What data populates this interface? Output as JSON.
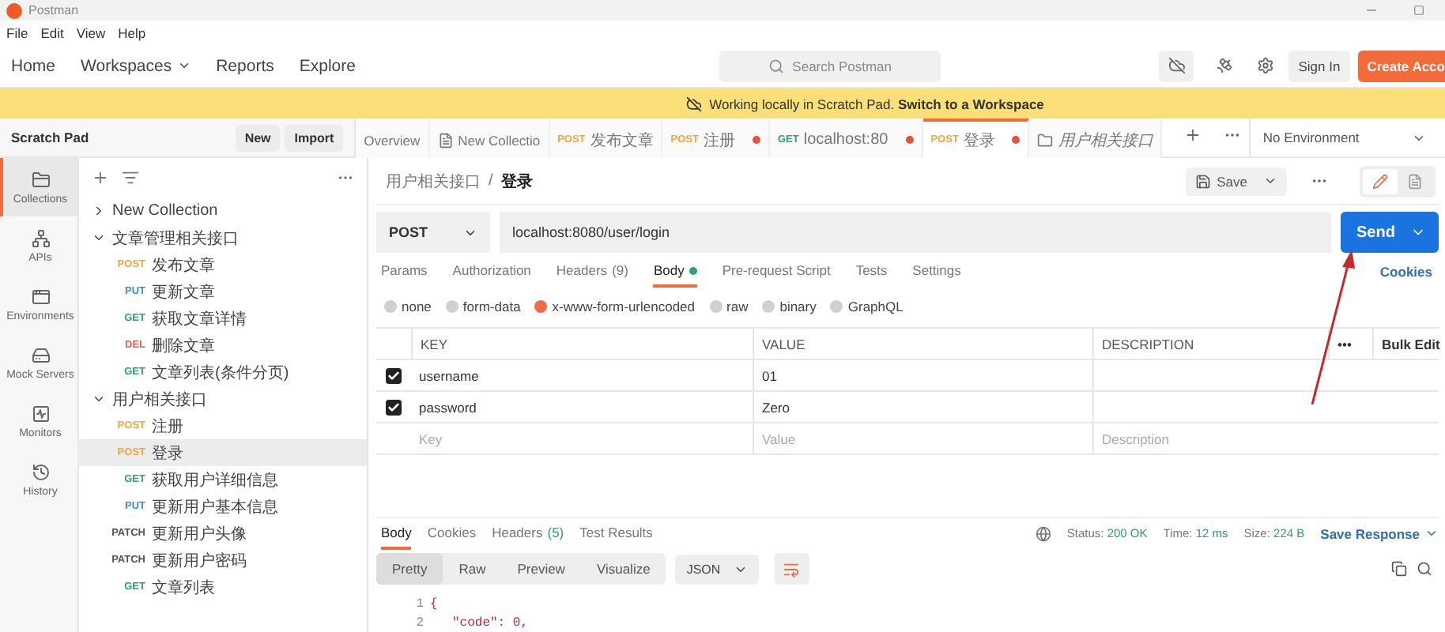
{
  "window": {
    "title": "Postman"
  },
  "menu": [
    "File",
    "Edit",
    "View",
    "Help"
  ],
  "nav": {
    "items": [
      {
        "label": "Home",
        "dropdown": false
      },
      {
        "label": "Workspaces",
        "dropdown": true
      },
      {
        "label": "Reports",
        "dropdown": false
      },
      {
        "label": "Explore",
        "dropdown": false
      }
    ],
    "search": {
      "placeholder": "Search Postman"
    },
    "sign_in": "Sign In",
    "create_account": "Create Acco"
  },
  "banner": {
    "text": "Working locally in Scratch Pad. **Switch to a Workspace**"
  },
  "sidebar": {
    "title": "Scratch Pad",
    "buttons": [
      "New",
      "Import"
    ],
    "nav": [
      {
        "label": "Collections",
        "selected": true
      },
      {
        "label": "APIs",
        "selected": false
      },
      {
        "label": "Environments",
        "selected": false
      },
      {
        "label": "Mock Servers",
        "selected": false
      },
      {
        "label": "Monitors",
        "selected": false
      },
      {
        "label": "History",
        "selected": false
      }
    ],
    "tree": [
      {
        "name": "New Collection",
        "expanded": false
      },
      {
        "name": "文章管理相关接口",
        "expanded": true,
        "children": [
          {
            "method": "POST",
            "name": "发布文章",
            "color": "#f0a63a",
            "selected": false
          },
          {
            "method": "PUT",
            "name": "更新文章",
            "color": "#3a8fd9",
            "selected": false
          },
          {
            "method": "GET",
            "name": "获取文章详情",
            "color": "#2ea36f",
            "selected": false
          },
          {
            "method": "DEL",
            "name": "删除文章",
            "color": "#e0614f",
            "selected": false
          },
          {
            "method": "GET",
            "name": "文章列表(条件分页)",
            "color": "#2ea36f",
            "selected": false
          }
        ]
      },
      {
        "name": "用户相关接口",
        "expanded": true,
        "children": [
          {
            "method": "POST",
            "name": "注册",
            "color": "#f0a63a",
            "selected": false
          },
          {
            "method": "POST",
            "name": "登录",
            "color": "#f0a63a",
            "selected": true
          },
          {
            "method": "GET",
            "name": "获取用户详细信息",
            "color": "#2ea36f",
            "selected": false
          },
          {
            "method": "PUT",
            "name": "更新用户基本信息",
            "color": "#3a8fd9",
            "selected": false
          },
          {
            "method": "PATCH",
            "name": "更新用户头像",
            "color": "#555555",
            "selected": false
          },
          {
            "method": "PATCH",
            "name": "更新用户密码",
            "color": "#555555",
            "selected": false
          },
          {
            "method": "GET",
            "name": "文章列表",
            "color": "#2ea36f",
            "selected": false
          }
        ]
      }
    ]
  },
  "tabs": [
    {
      "kind": "page",
      "label": "Overview",
      "selected": false,
      "unsaved": false
    },
    {
      "kind": "collection",
      "label": "New Collectio",
      "selected": false,
      "unsaved": false
    },
    {
      "kind": "request",
      "method": "POST",
      "color": "#f0a63a",
      "label": "发布文章",
      "selected": false,
      "unsaved": false
    },
    {
      "kind": "request",
      "method": "POST",
      "color": "#f0a63a",
      "label": "注册",
      "selected": false,
      "unsaved": true
    },
    {
      "kind": "request",
      "method": "GET",
      "color": "#2ea36f",
      "label": "localhost:80",
      "selected": false,
      "unsaved": true
    },
    {
      "kind": "request",
      "method": "POST",
      "color": "#f0a63a",
      "label": "登录",
      "selected": true,
      "unsaved": true
    },
    {
      "kind": "folder",
      "label": "用户相关接口",
      "selected": false,
      "unsaved": false
    }
  ],
  "environment": "No Environment",
  "request": {
    "breadcrumb": [
      "用户相关接口",
      "登录"
    ],
    "separator": "/",
    "save": "Save",
    "method": "POST",
    "url": "localhost:8080/user/login",
    "send": "Send",
    "cookies": "Cookies",
    "tabs": [
      {
        "label": "Params",
        "selected": false,
        "indicator": false
      },
      {
        "label": "Authorization",
        "selected": false,
        "indicator": false
      },
      {
        "label": "Headers",
        "count": "(9)",
        "selected": false,
        "indicator": false
      },
      {
        "label": "Body",
        "selected": true,
        "indicator": true
      },
      {
        "label": "Pre-request Script",
        "selected": false,
        "indicator": false
      },
      {
        "label": "Tests",
        "selected": false,
        "indicator": false
      },
      {
        "label": "Settings",
        "selected": false,
        "indicator": false
      }
    ],
    "body_types": [
      {
        "label": "none",
        "selected": false
      },
      {
        "label": "form-data",
        "selected": false
      },
      {
        "label": "x-www-form-urlencoded",
        "selected": true
      },
      {
        "label": "raw",
        "selected": false
      },
      {
        "label": "binary",
        "selected": false
      },
      {
        "label": "GraphQL",
        "selected": false
      }
    ],
    "table": {
      "columns": [
        "KEY",
        "VALUE",
        "DESCRIPTION"
      ],
      "more": "•••",
      "bulk_edit": "Bulk Edit",
      "rows": [
        {
          "checked": true,
          "key": "username",
          "value": "01"
        },
        {
          "checked": true,
          "key": "password",
          "value": "Zero"
        }
      ],
      "placeholder": {
        "key": "Key",
        "value": "Value",
        "description": "Description"
      }
    }
  },
  "response": {
    "tabs": [
      {
        "label": "Body",
        "selected": true
      },
      {
        "label": "Cookies",
        "selected": false
      },
      {
        "label": "Headers",
        "count": "(5)",
        "selected": false
      },
      {
        "label": "Test Results",
        "selected": false
      }
    ],
    "stats": [
      {
        "label": "Status:",
        "value": "200 OK"
      },
      {
        "label": "Time:",
        "value": "12 ms"
      },
      {
        "label": "Size:",
        "value": "224 B"
      }
    ],
    "save": "Save Response",
    "views": [
      {
        "label": "Pretty",
        "selected": true
      },
      {
        "label": "Raw",
        "selected": false
      },
      {
        "label": "Preview",
        "selected": false
      },
      {
        "label": "Visualize",
        "selected": false
      }
    ],
    "format": "JSON",
    "lines": [
      {
        "number": "1",
        "text": "{"
      },
      {
        "number": "2",
        "text": "\"code\": 0,"
      }
    ]
  }
}
